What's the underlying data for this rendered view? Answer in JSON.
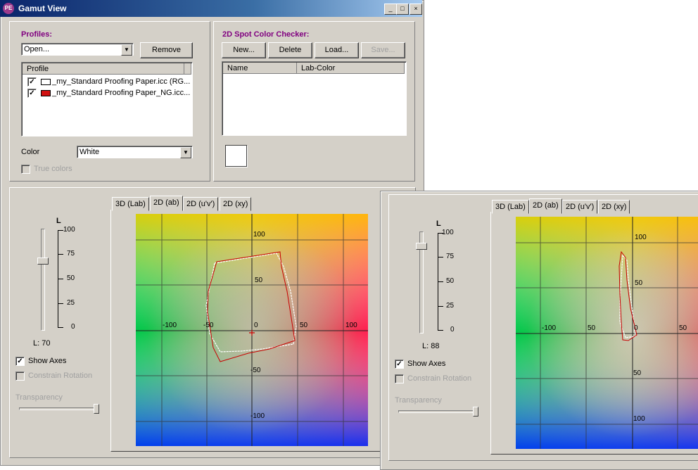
{
  "window": {
    "title": "Gamut View",
    "icon_text": "PE",
    "controls": {
      "minimize": "_",
      "maximize": "□",
      "close": "×"
    }
  },
  "profiles": {
    "title": "Profiles:",
    "open_combo": "Open...",
    "remove_button": "Remove",
    "list_header": "Profile",
    "items": [
      {
        "checked": true,
        "swatch": "#ffffff",
        "label": "_my_Standard Proofing Paper.icc (RG..."
      },
      {
        "checked": true,
        "swatch": "#d01010",
        "label": "_my_Standard Proofing Paper_NG.icc..."
      }
    ],
    "color_label": "Color",
    "color_value": "White",
    "true_colors_label": "True colors",
    "true_colors_checked": false
  },
  "spot": {
    "title": "2D Spot Color Checker:",
    "buttons": {
      "new": "New...",
      "delete": "Delete",
      "load": "Load...",
      "save": "Save..."
    },
    "columns": {
      "name": "Name",
      "lab": "Lab-Color"
    },
    "swatch_color": "#ffffff"
  },
  "view1": {
    "tabs": [
      "3D (Lab)",
      "2D (ab)",
      "2D (u'v')",
      "2D (xy)"
    ],
    "active_tab": "2D (ab)",
    "slider_label": "L",
    "ticks": [
      "100",
      "75",
      "50",
      "25",
      "0"
    ],
    "l_readout": "L: 70",
    "l_value": 70,
    "show_axes_label": "Show Axes",
    "show_axes_checked": true,
    "constrain_label": "Constrain Rotation",
    "constrain_checked": false,
    "transparency_label": "Transparency",
    "transparency_level": 1.0,
    "axis_labels": {
      "top": "100",
      "upper": "50",
      "left_far": "-100",
      "left_near": "-50",
      "origin": "0",
      "right_near": "50",
      "right_far": "100",
      "lower": "-50",
      "bottom": "-100"
    }
  },
  "view2": {
    "tabs": [
      "3D (Lab)",
      "2D (ab)",
      "2D (u'v')",
      "2D (xy)"
    ],
    "active_tab": "2D (ab)",
    "slider_label": "L",
    "ticks": [
      "100",
      "75",
      "50",
      "25",
      "0"
    ],
    "l_readout": "L: 88",
    "l_value": 88,
    "show_axes_label": "Show Axes",
    "show_axes_checked": true,
    "constrain_label": "Constrain Rotation",
    "constrain_checked": false,
    "transparency_label": "Transparency",
    "transparency_level": 1.0,
    "axis_labels": {
      "top": "100",
      "upper": "50",
      "left_far": "-100",
      "left_near": "50",
      "origin": "0",
      "right_near": "50",
      "lower": "50",
      "bottom": "100"
    }
  }
}
